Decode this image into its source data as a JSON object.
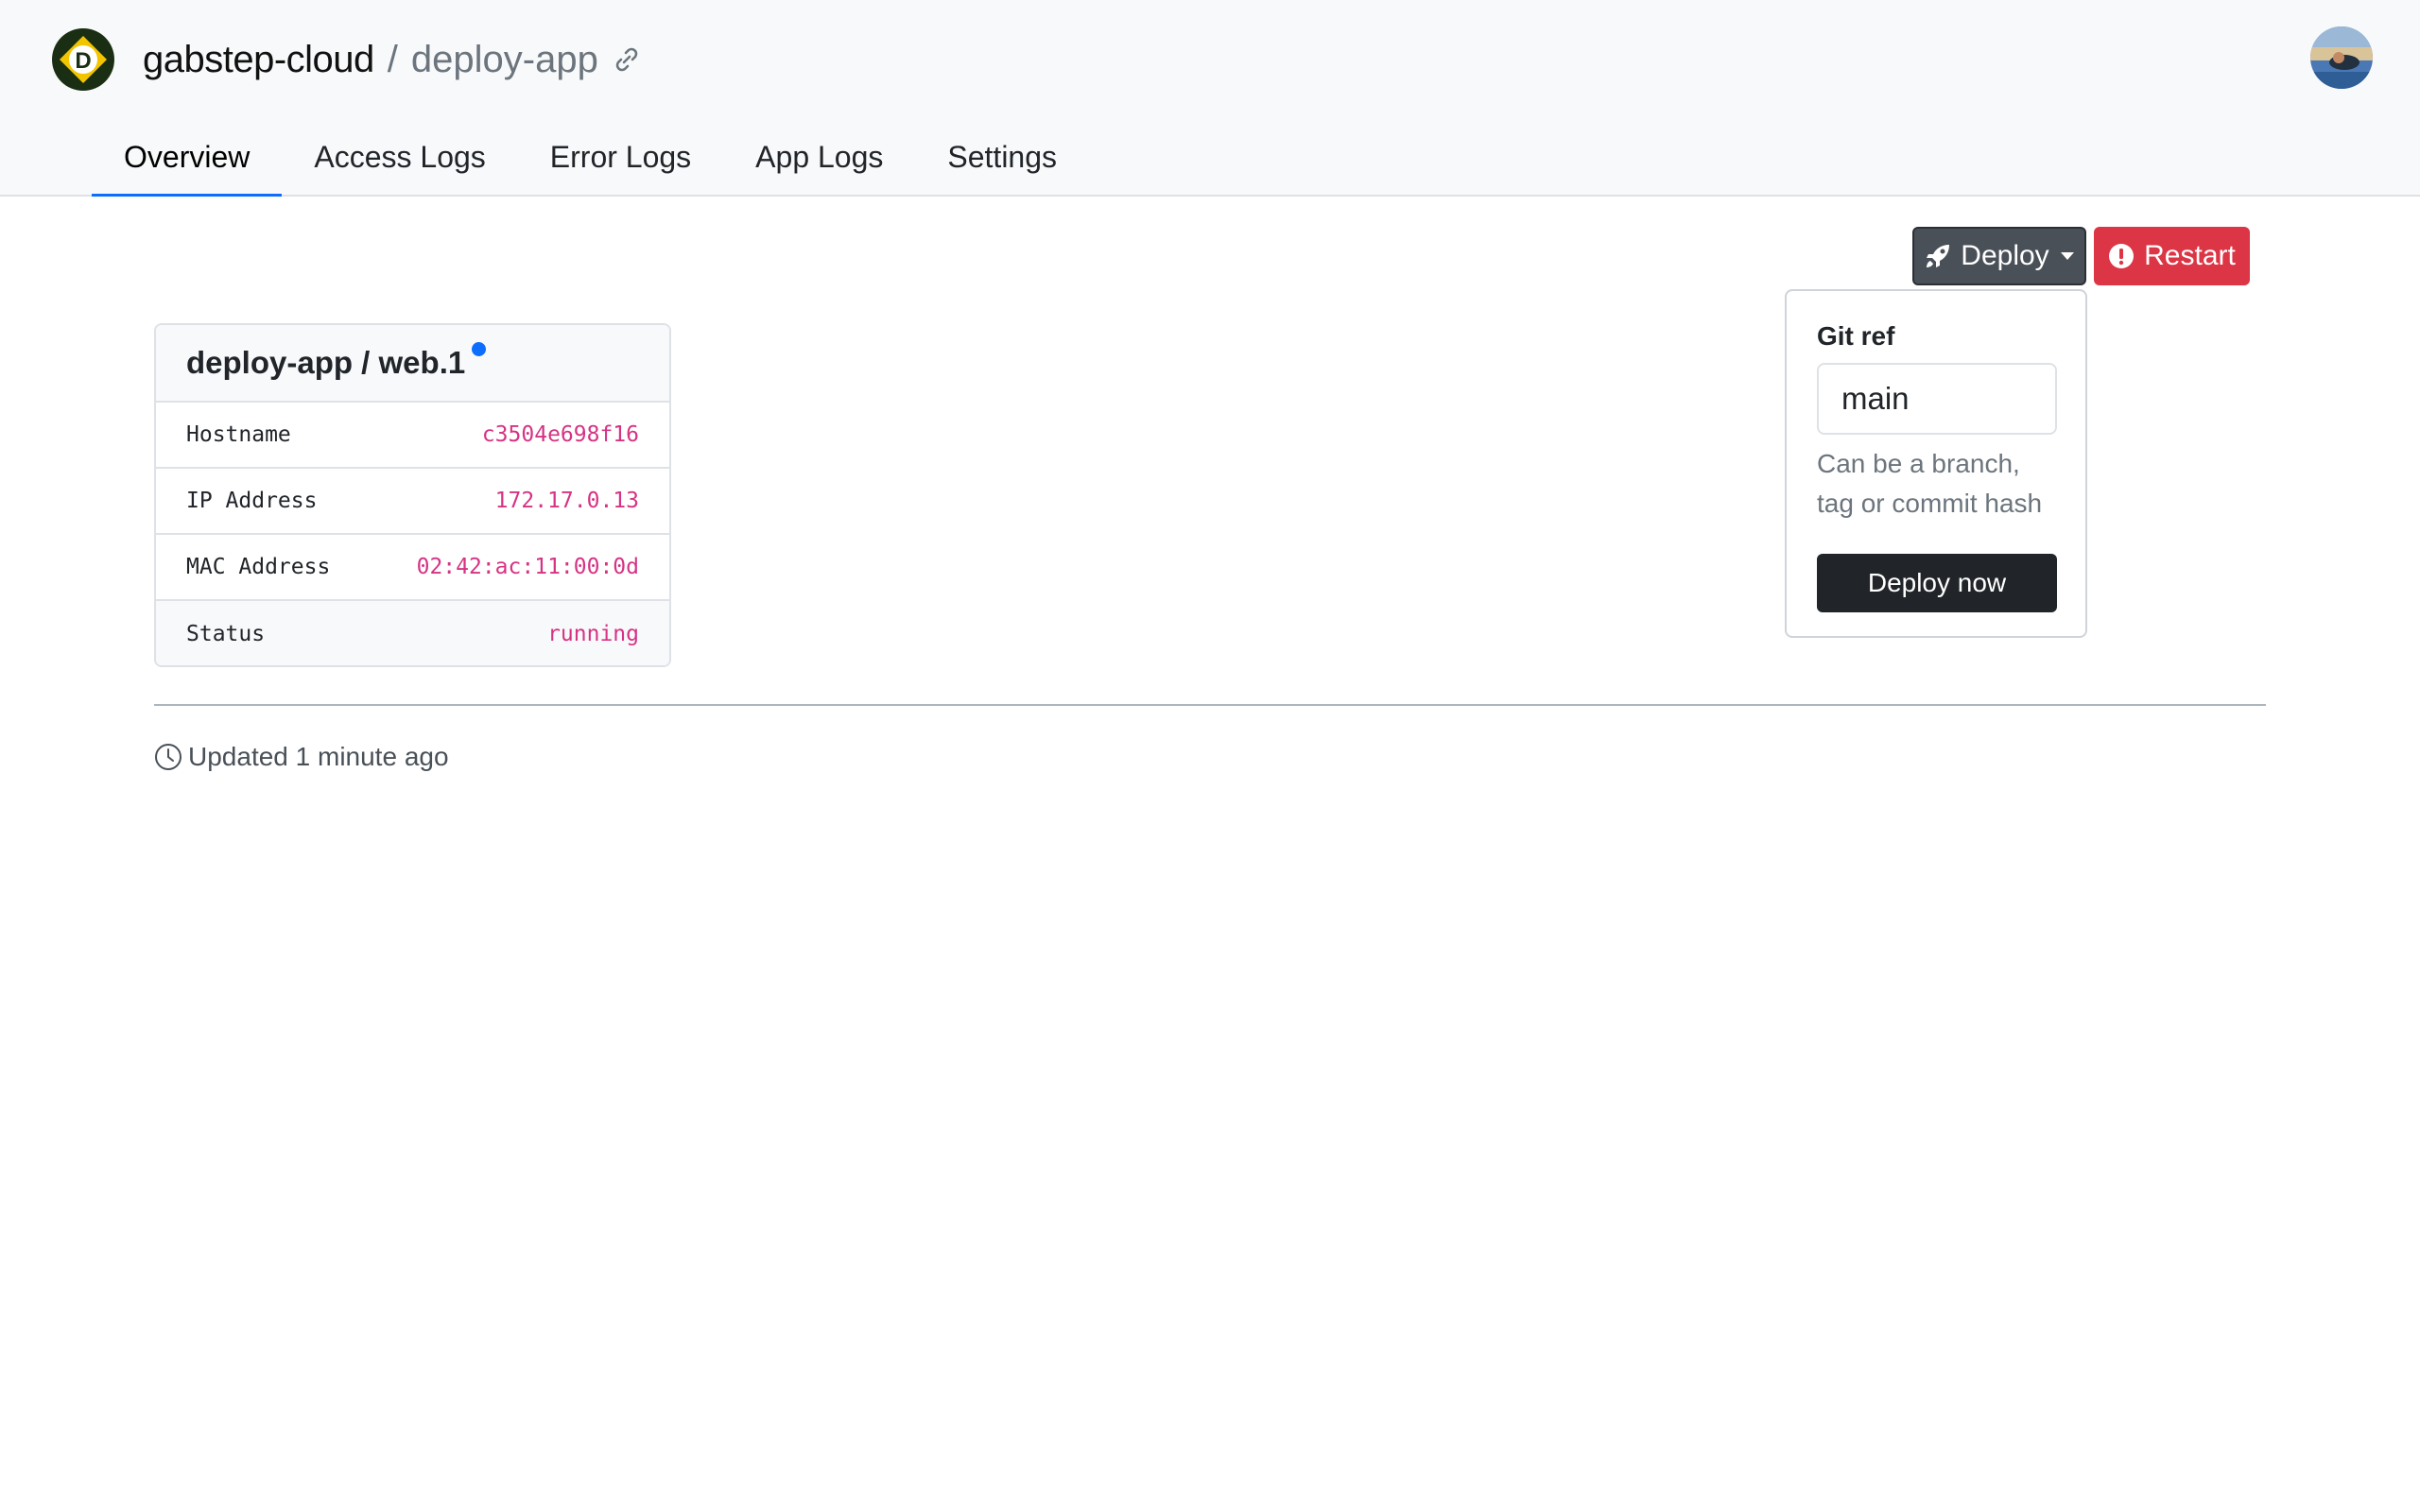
{
  "header": {
    "org": "gabstep-cloud",
    "separator": "/",
    "app": "deploy-app",
    "logo_letter": "D"
  },
  "tabs": [
    {
      "label": "Overview",
      "active": true
    },
    {
      "label": "Access Logs"
    },
    {
      "label": "Error Logs"
    },
    {
      "label": "App Logs"
    },
    {
      "label": "Settings"
    }
  ],
  "actions": {
    "deploy_label": "Deploy",
    "restart_label": "Restart"
  },
  "deploy_dropdown": {
    "label": "Git ref",
    "input_value": "main",
    "help_line1": "Can be a branch,",
    "help_line2": "tag or commit hash",
    "submit_label": "Deploy now"
  },
  "container": {
    "title": "deploy-app / web.1",
    "rows": [
      {
        "key": "Hostname",
        "value": "c3504e698f16"
      },
      {
        "key": "IP Address",
        "value": "172.17.0.13"
      },
      {
        "key": "MAC Address",
        "value": "02:42:ac:11:00:0d"
      },
      {
        "key": "Status",
        "value": "running"
      }
    ]
  },
  "footer": {
    "updated": "Updated 1 minute ago"
  },
  "colors": {
    "accent": "#0d6efd",
    "danger": "#dc3545",
    "value": "#d63384",
    "logo_yellow": "#f2c500",
    "logo_green": "#1a2e14"
  }
}
